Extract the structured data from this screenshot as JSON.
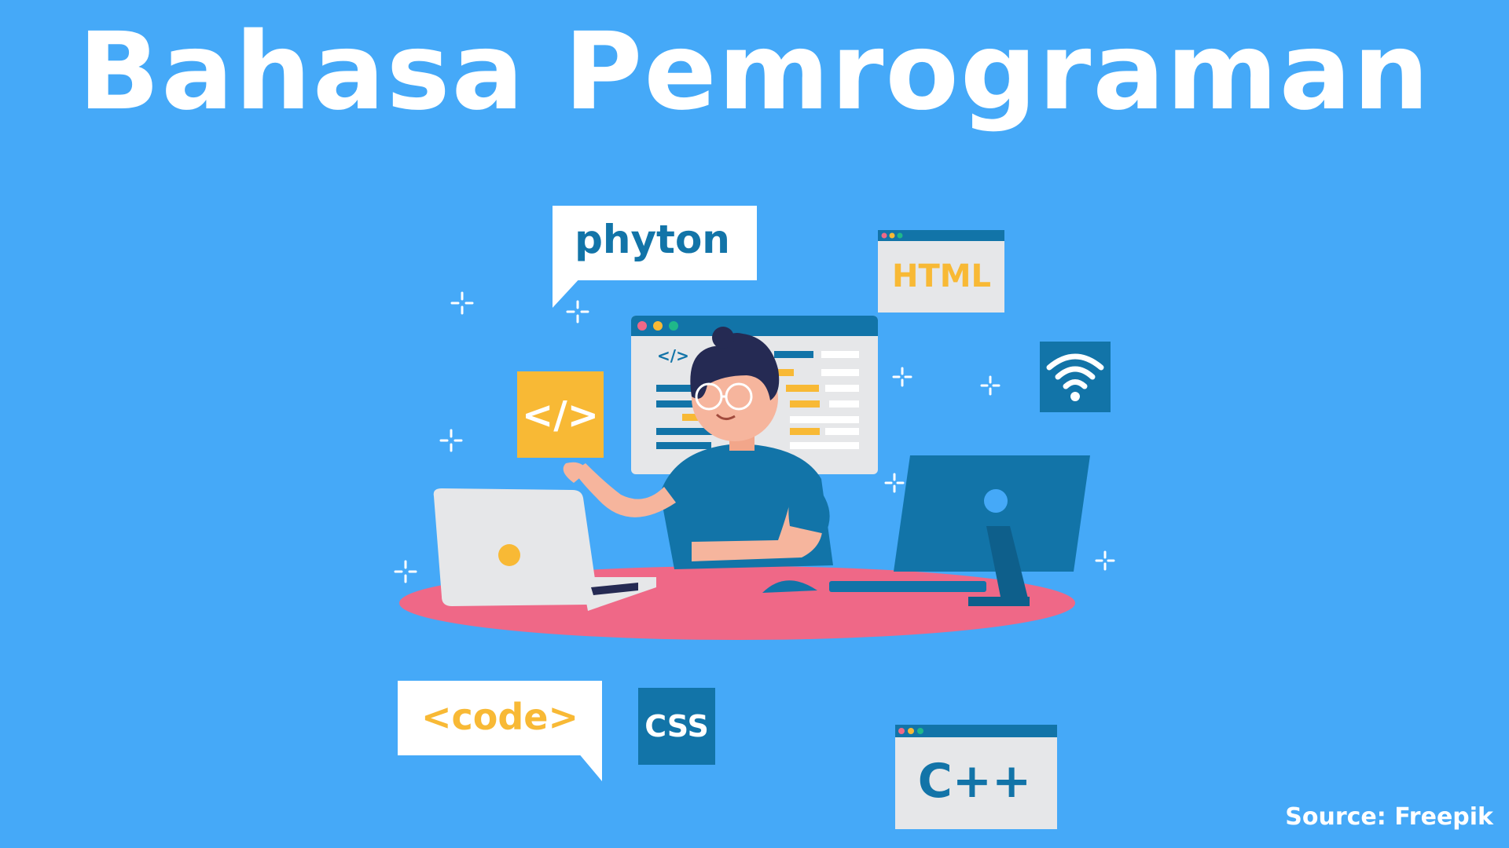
{
  "title": "Bahasa Pemrograman",
  "source": "Source: Freepik",
  "labels": {
    "python": "phyton",
    "html": "HTML",
    "code_tag": "</>",
    "screen_code_tag": "</>",
    "code": "<code>",
    "css": "CSS",
    "cpp": "C++"
  },
  "colors": {
    "background": "#45a9f8",
    "accent_yellow": "#f8b935",
    "accent_teal": "#1274a8",
    "table_pink": "#ef6887",
    "panel_light": "#e6e7e9"
  },
  "icons": [
    "wifi-icon",
    "laptop-icon",
    "desktop-monitor-icon",
    "sparkle-icon",
    "window-dots-icon"
  ]
}
